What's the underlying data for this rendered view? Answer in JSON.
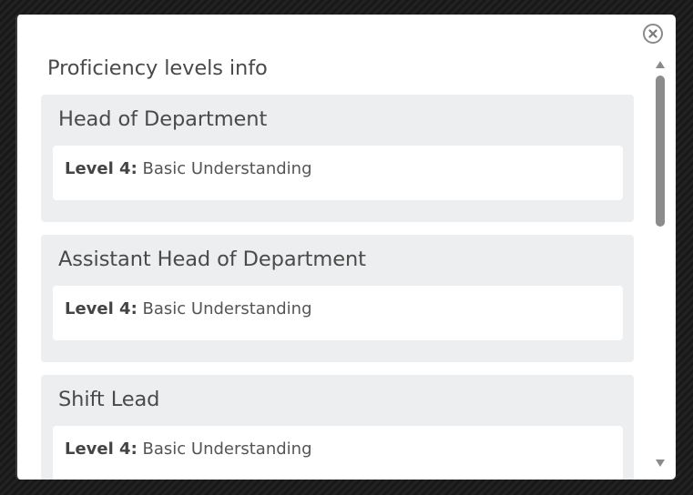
{
  "dialog": {
    "title": "Proficiency levels info",
    "close_icon": "close-icon",
    "cards": [
      {
        "role": "Head of Department",
        "level_label": "Level 4:",
        "level_value": "Basic Understanding"
      },
      {
        "role": "Assistant Head of Department",
        "level_label": "Level 4:",
        "level_value": "Basic Understanding"
      },
      {
        "role": "Shift Lead",
        "level_label": "Level 4:",
        "level_value": "Basic Understanding"
      }
    ]
  },
  "colors": {
    "card_background": "#edeeef",
    "title_text": "#4a4a4a",
    "scroll_thumb": "#8c8c8c"
  },
  "icons": {
    "scroll_up": "scroll-up-arrow-icon",
    "scroll_down": "scroll-down-arrow-icon"
  }
}
